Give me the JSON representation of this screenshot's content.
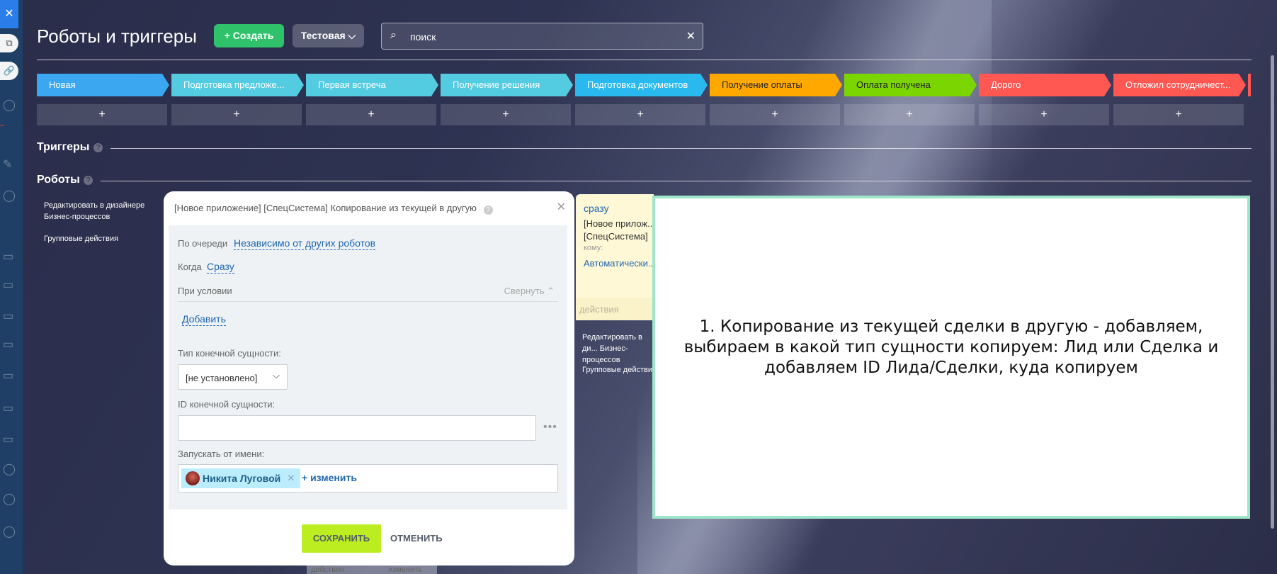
{
  "header": {
    "title": "Роботы и триггеры",
    "create_label": "Создать",
    "test_label": "Тестовая",
    "search_value": "поиск"
  },
  "stages": [
    {
      "label": "Новая",
      "color": "#3aa7f0"
    },
    {
      "label": "Подготовка предложе...",
      "color": "#53cbe0"
    },
    {
      "label": "Первая встреча",
      "color": "#53cbe0"
    },
    {
      "label": "Получение решения",
      "color": "#53cbe0"
    },
    {
      "label": "Подготовка документов",
      "color": "#29b9ef"
    },
    {
      "label": "Получение оплаты",
      "color": "#ffa900"
    },
    {
      "label": "Оплата получена",
      "color": "#7bd500"
    },
    {
      "label": "Дорого",
      "color": "#ff5752"
    },
    {
      "label": "Отложил сотрудничест...",
      "color": "#ff5752"
    }
  ],
  "add_symbol": "+",
  "sections": {
    "triggers": "Триггеры",
    "robots": "Роботы"
  },
  "side_links": {
    "edit_designer": "Редактировать в дизайнере Бизнес-процессов",
    "group_actions": "Групповые действия",
    "edit_designer_partial": "Редактировать в ди... Бизнес-процессов",
    "group_actions_partial": "Групповые действи..."
  },
  "dialog": {
    "title": "[Новое приложение] [СпецСистема] Копирование из текущей в другую",
    "queue_label": "По очереди",
    "queue_value": "Независимо от других роботов",
    "when_label": "Когда",
    "when_value": "Сразу",
    "condition_label": "При условии",
    "collapse_label": "Свернуть",
    "add_label": "Добавить",
    "entity_type_label": "Тип конечной сущности:",
    "entity_type_value": "[не установлено]",
    "entity_id_label": "ID конечной сущности:",
    "run_as_label": "Запускать от имени:",
    "user_name": "Никита Луговой",
    "change_label": "+ изменить",
    "save_label": "СОХРАНИТЬ",
    "cancel_label": "ОТМЕНИТЬ"
  },
  "robot_card": {
    "when": "сразу",
    "line1": "[Новое прилож...",
    "line2": "[СпецСистема]",
    "to_label": "кому:",
    "to_value": "Автоматически...",
    "footer": "действия"
  },
  "annotation": {
    "text": "1. Копирование из текущей сделки в другую - добавляем, выбираем в какой тип сущности копируем: Лид или Сделка и добавляем ID Лида/Сделки, куда копируем"
  },
  "bottom": {
    "ghost_left": "действия",
    "ghost_right": "изменить"
  }
}
